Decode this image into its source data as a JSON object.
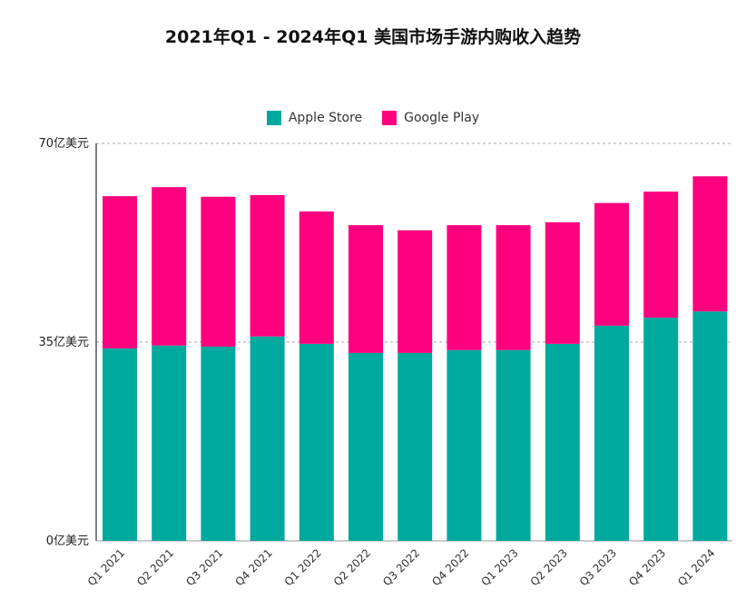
{
  "chart_data": {
    "type": "bar",
    "stacked": true,
    "title": "2021年Q1 - 2024年Q1 美国市场手游内购收入趋势",
    "xlabel": "",
    "ylabel": "",
    "ylim": [
      0,
      70
    ],
    "yticks": [
      0,
      35,
      70
    ],
    "ytick_labels": [
      "0亿美元",
      "35亿美元",
      "70亿美元"
    ],
    "grid": true,
    "legend_position": "top-center",
    "categories": [
      "Q1 2021",
      "Q2 2021",
      "Q3 2021",
      "Q4 2021",
      "Q1 2022",
      "Q2 2022",
      "Q3 2022",
      "Q4 2022",
      "Q1 2023",
      "Q2 2023",
      "Q3 2023",
      "Q4 2023",
      "Q1 2024"
    ],
    "series": [
      {
        "name": "Apple Store",
        "color": "#00A99D",
        "values": [
          33.9,
          34.4,
          34.2,
          36.0,
          34.7,
          33.1,
          33.1,
          33.6,
          33.6,
          34.7,
          37.9,
          39.3,
          40.4
        ]
      },
      {
        "name": "Google Play",
        "color": "#FF007F",
        "values": [
          26.8,
          27.9,
          26.4,
          24.9,
          23.3,
          22.5,
          21.6,
          22.0,
          22.0,
          21.4,
          21.6,
          22.2,
          23.8
        ]
      }
    ]
  }
}
